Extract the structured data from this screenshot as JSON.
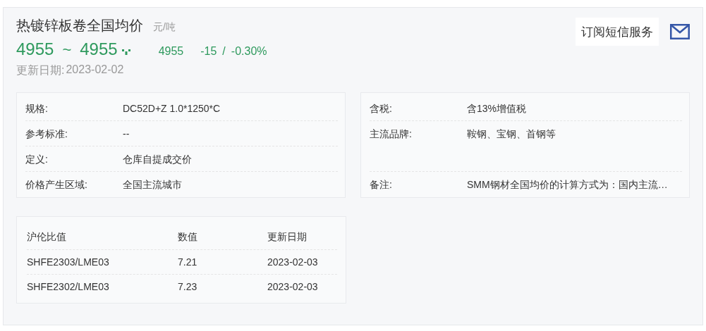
{
  "title": "热镀锌板卷全国均价",
  "unit": "元/吨",
  "price": {
    "low": "4955",
    "separator": "~",
    "high": "4955",
    "average": "4955",
    "change": "-15",
    "slash": "/",
    "change_percent": "-0.30%",
    "falling": true
  },
  "updated": {
    "label": "更新日期:",
    "value": "2023-02-02"
  },
  "subscribe_button": "订阅短信服务",
  "details_left": [
    {
      "label": "规格:",
      "value": "DC52D+Z 1.0*1250*C"
    },
    {
      "label": "参考标准:",
      "value": "--"
    },
    {
      "label": "定义:",
      "value": "仓库自提成交价"
    },
    {
      "label": "价格产生区域:",
      "value": "全国主流城市"
    }
  ],
  "details_right": [
    {
      "label": "含税:",
      "value": "含13%增值税",
      "tall": false
    },
    {
      "label": "主流品牌:",
      "value": "鞍钢、宝钢、首钢等",
      "tall": true
    },
    {
      "label": "备注:",
      "value": "SMM钢材全国均价的计算方式为：国内主流…",
      "tall": false
    }
  ],
  "ratio_table": {
    "columns": [
      "沪伦比值",
      "数值",
      "更新日期"
    ],
    "rows": [
      [
        "SHFE2303/LME03",
        "7.21",
        "2023-02-03"
      ],
      [
        "SHFE2302/LME03",
        "7.23",
        "2023-02-03"
      ]
    ]
  }
}
